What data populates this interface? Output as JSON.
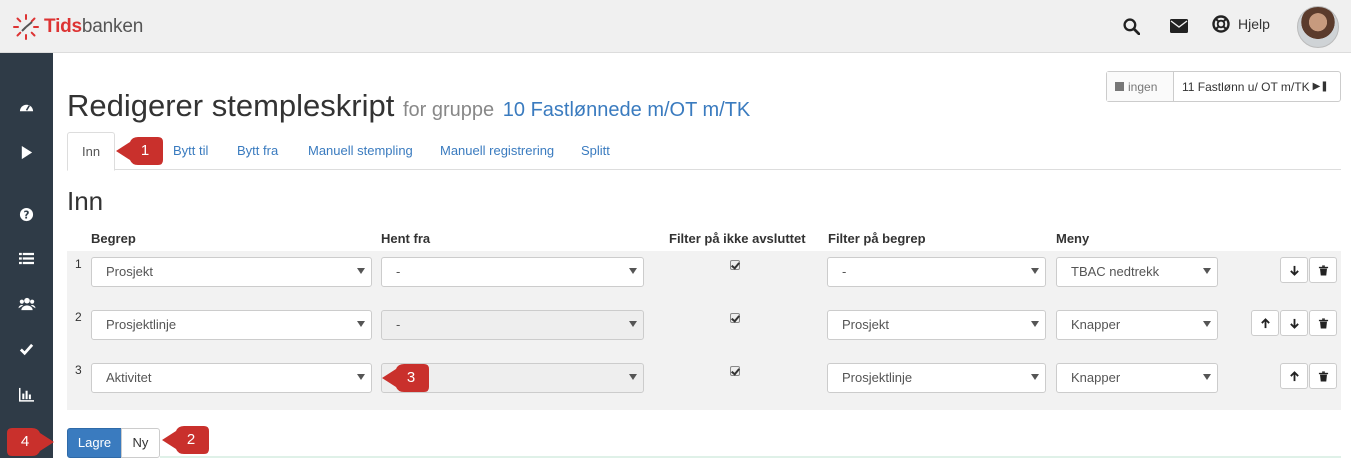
{
  "app": {
    "brand_red": "Tids",
    "brand_rest": "banken"
  },
  "header": {
    "help_label": "Hjelp"
  },
  "page": {
    "title": "Redigerer stempleskript",
    "subtitle_prefix": "for gruppe",
    "group_name": "10 Fastlønnede m/OT m/TK"
  },
  "group_toggle": {
    "first_label": "ingen",
    "second_label": "11 Fastlønn u/ OT m/TK"
  },
  "tabs": [
    {
      "label": "Inn",
      "active": true
    },
    {
      "label": "Bytt til"
    },
    {
      "label": "Bytt fra"
    },
    {
      "label": "Manuell stempling"
    },
    {
      "label": "Manuell registrering"
    },
    {
      "label": "Splitt"
    }
  ],
  "section_title": "Inn",
  "table": {
    "headers": [
      "Begrep",
      "Hent fra",
      "Filter på ikke avsluttet",
      "Filter på begrep",
      "Meny"
    ],
    "rows": [
      {
        "num": "1",
        "begrep": "Prosjekt",
        "hent_fra": "-",
        "hent_disabled": false,
        "filter_checked": true,
        "filter_begrep": "-",
        "meny": "TBAC nedtrekk",
        "can_up": false,
        "can_down": true
      },
      {
        "num": "2",
        "begrep": "Prosjektlinje",
        "hent_fra": "-",
        "hent_disabled": true,
        "filter_checked": true,
        "filter_begrep": "Prosjekt",
        "meny": "Knapper",
        "can_up": true,
        "can_down": true
      },
      {
        "num": "3",
        "begrep": "Aktivitet",
        "hent_fra": "",
        "hent_disabled": true,
        "filter_checked": true,
        "filter_begrep": "Prosjektlinje",
        "meny": "Knapper",
        "can_up": true,
        "can_down": false
      }
    ]
  },
  "actions": {
    "save_label": "Lagre",
    "new_label": "Ny"
  },
  "callouts": [
    "1",
    "2",
    "3",
    "4"
  ],
  "colors": {
    "accent": "#3a7bbf",
    "sidebar": "#2f3b47",
    "callout": "#c9302c"
  },
  "icons": {
    "sidebar": [
      "dashboard-icon",
      "play-icon",
      "help-icon",
      "list-icon",
      "users-icon",
      "check-icon",
      "bar-chart-icon"
    ],
    "header": [
      "search-icon",
      "envelope-icon",
      "lifebuoy-icon"
    ]
  }
}
